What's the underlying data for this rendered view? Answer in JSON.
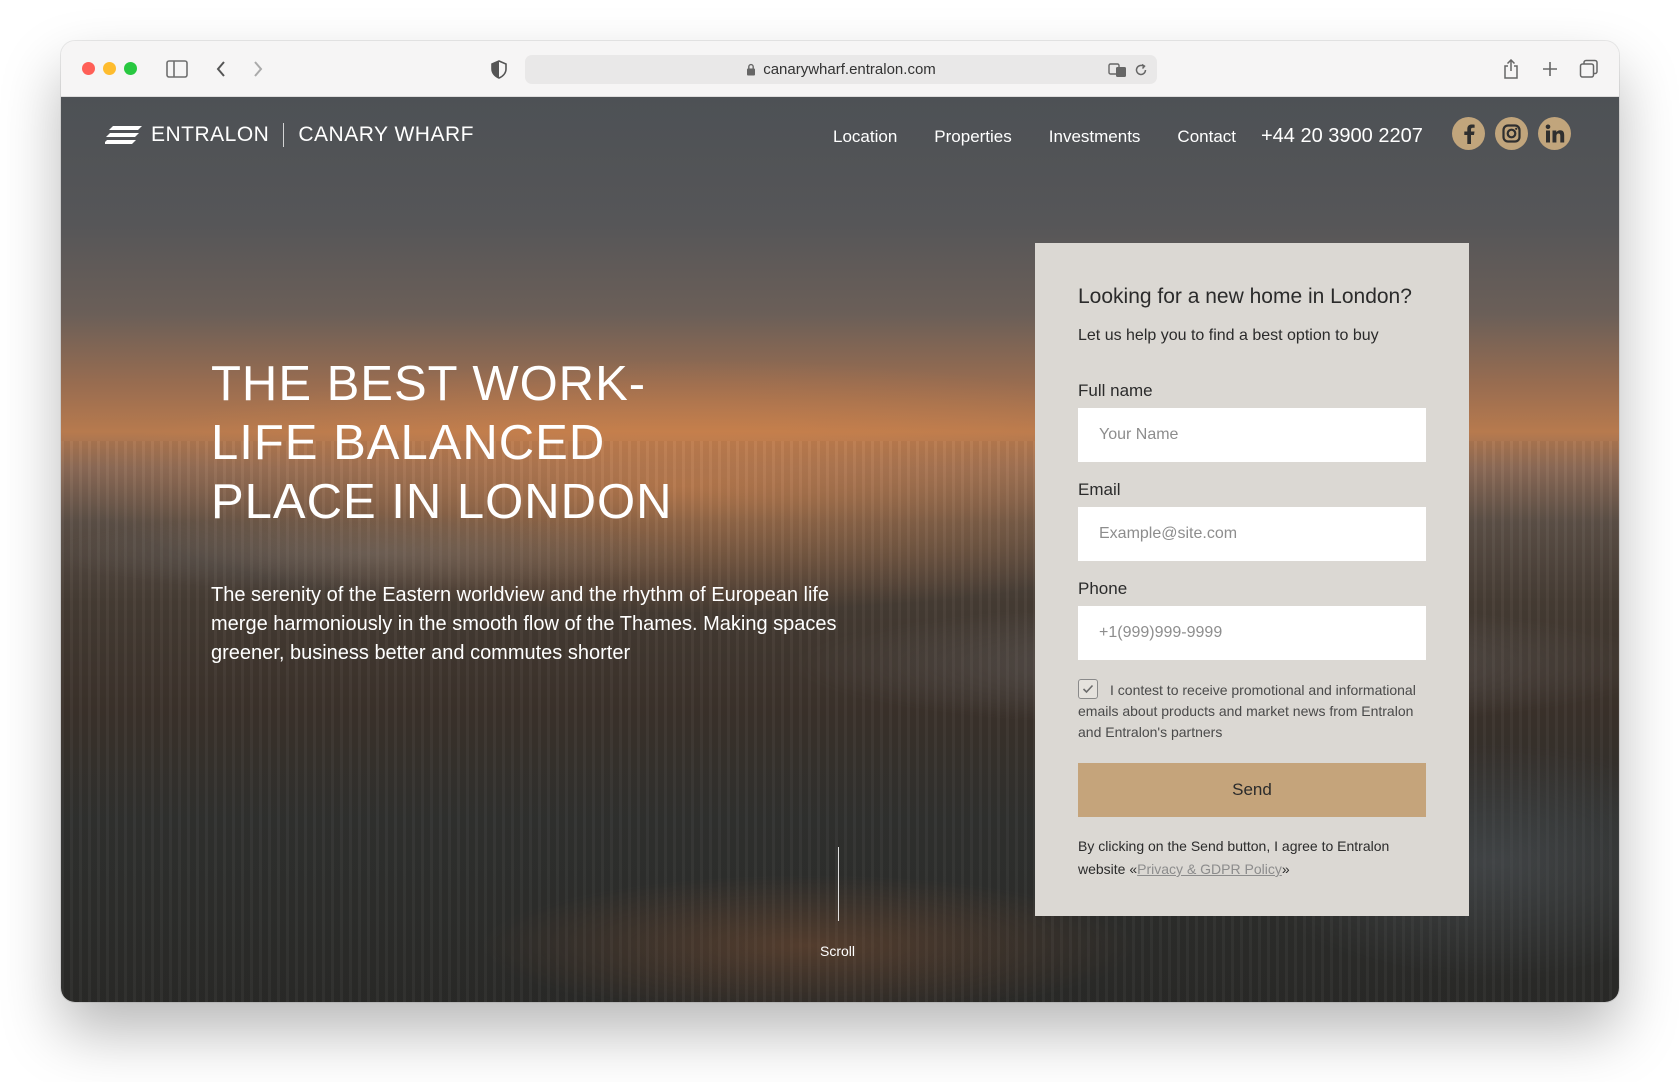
{
  "browser": {
    "url": "canarywharf.entralon.com"
  },
  "header": {
    "brand": "ENTRALON",
    "sub_brand": "CANARY WHARF",
    "nav": [
      "Location",
      "Properties",
      "Investments",
      "Contact"
    ],
    "phone": "+44 20 3900 2207",
    "social": [
      "facebook-icon",
      "instagram-icon",
      "linkedin-icon"
    ],
    "accent_color": "#c1a57c"
  },
  "hero": {
    "title_lines": [
      "THE BEST WORK-",
      "LIFE BALANCED",
      "PLACE IN LONDON"
    ],
    "subtitle": "The serenity of the Eastern worldview and the rhythm of European life merge harmoniously in the smooth flow of the Thames. Making spaces greener, business better and commutes shorter",
    "scroll_label": "Scroll"
  },
  "form": {
    "heading": "Looking for a new home in London?",
    "subheading": "Let us help you to find a best option to buy",
    "fields": [
      {
        "label": "Full name",
        "placeholder": "Your Name"
      },
      {
        "label": "Email",
        "placeholder": "Example@site.com"
      },
      {
        "label": "Phone",
        "placeholder": "+1(999)999-9999"
      }
    ],
    "consent_text": "I contest to receive promotional and informational emails about products and market news from Entralon and Entralon's partners",
    "consent_checked": true,
    "send_label": "Send",
    "agree_prefix": "By clicking on the Send button, I agree to Entralon website «",
    "agree_link": "Privacy & GDPR Policy",
    "agree_suffix": "»",
    "card_color": "#dbd8d3",
    "button_color": "#c5a47b"
  }
}
